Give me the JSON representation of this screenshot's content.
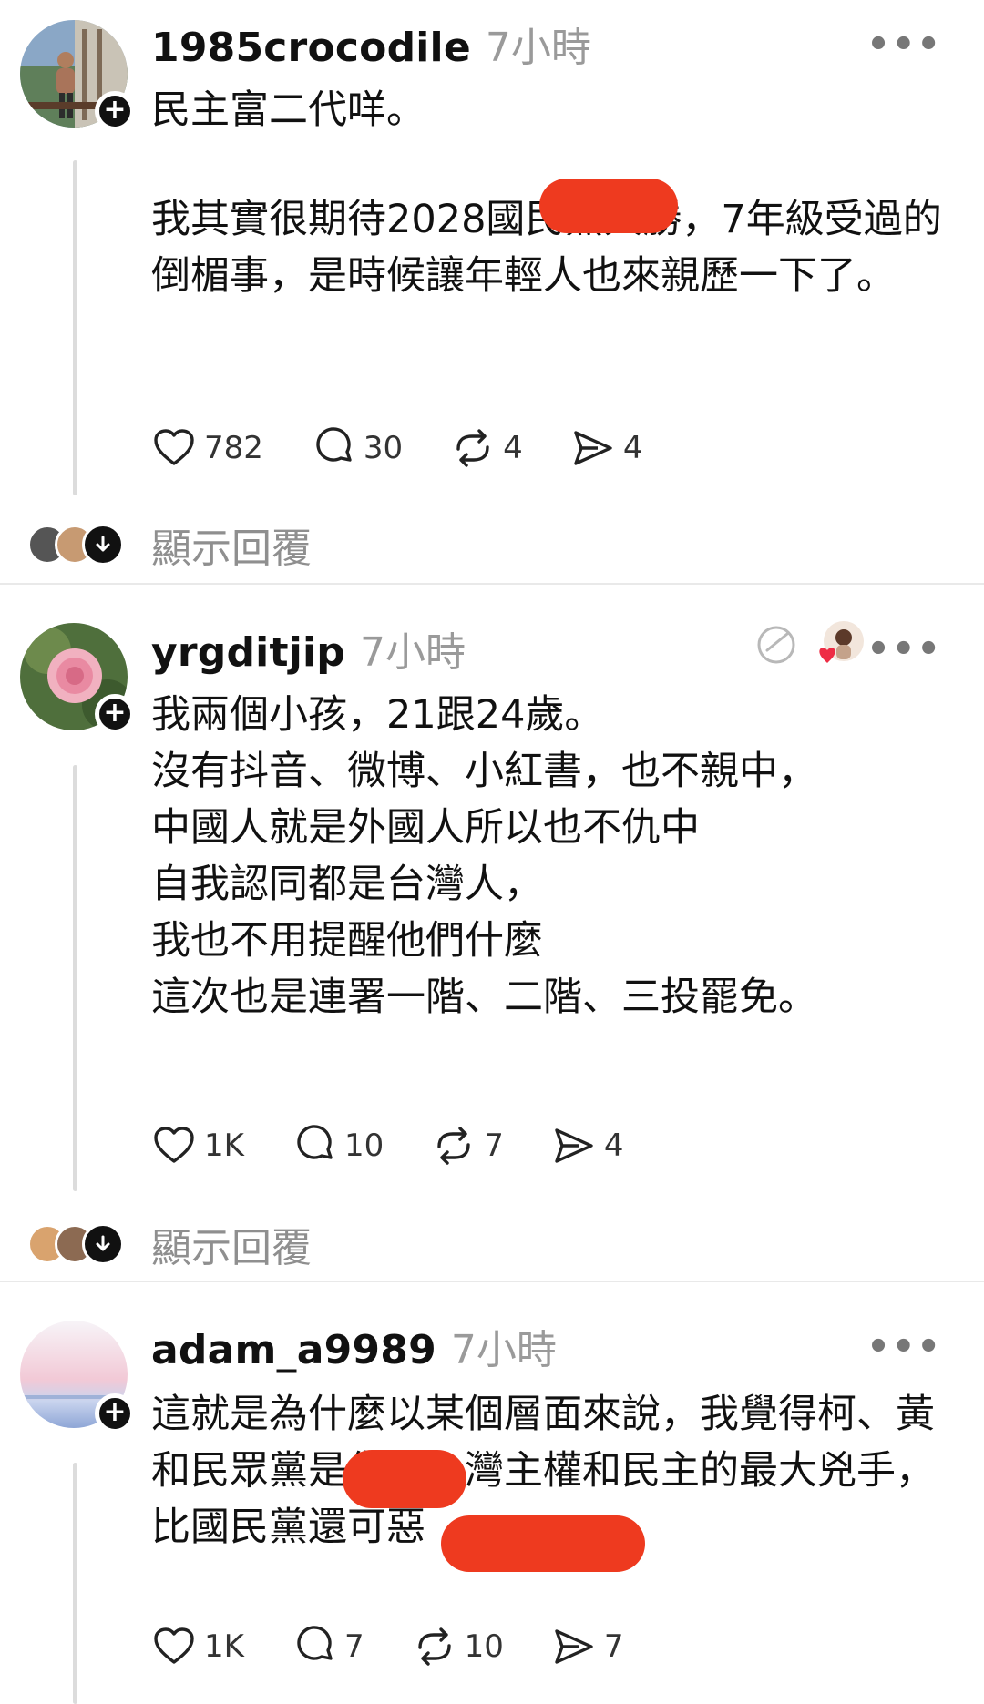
{
  "posts": [
    {
      "username": "1985crocodile",
      "time": "7小時",
      "more": "•••",
      "paragraphs": [
        "民主富二代咩。",
        "我其實很期待2028國民黨大勝，7年級受過的倒楣事，是時候讓年輕人也來親歷一下了。"
      ],
      "likes": "782",
      "comments": "30",
      "reposts": "4",
      "shares": "4",
      "show_replies": "顯示回覆"
    },
    {
      "username": "yrgditjip",
      "time": "7小時",
      "more": "•••",
      "lines": [
        "我兩個小孩，21跟24歲。",
        "沒有抖音、微博、小紅書，也不親中，",
        "中國人就是外國人所以也不仇中",
        "自我認同都是台灣人，",
        "我也不用提醒他們什麼",
        "這次也是連署一階、二階、三投罷免。"
      ],
      "likes": "1K",
      "comments": "10",
      "reposts": "7",
      "shares": "4",
      "show_replies": "顯示回覆"
    },
    {
      "username": "adam_a9989",
      "time": "7小時",
      "more": "•••",
      "paragraph": "這就是為什麼以某個層面來說，我覺得柯、黃和民眾黨是傷害台灣主權和民主的最大兇手，比國民黨還可惡",
      "likes": "1K",
      "comments": "7",
      "reposts": "10",
      "shares": "7"
    }
  ],
  "icons": {
    "like": "heart-icon",
    "comment": "comment-bubble-icon",
    "repost": "repost-icon",
    "share": "send-icon",
    "follow": "plus-icon",
    "more": "more-icon"
  },
  "colors": {
    "redaction": "#ee3a1f",
    "muted": "#9a9a9a",
    "divider": "#e9e9e9"
  }
}
